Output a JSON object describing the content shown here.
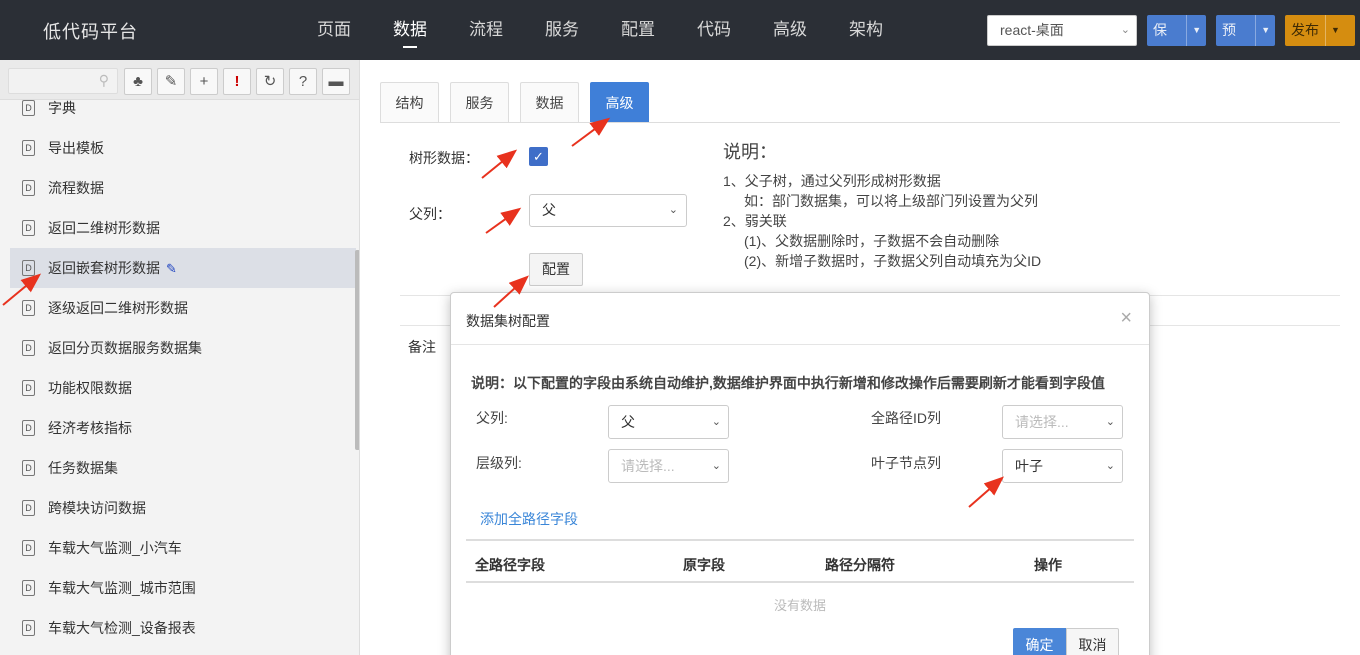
{
  "app": {
    "title": "低代码平台"
  },
  "topnav": {
    "items": [
      {
        "label": "页面",
        "active": false
      },
      {
        "label": "数据",
        "active": true
      },
      {
        "label": "流程",
        "active": false
      },
      {
        "label": "服务",
        "active": false
      },
      {
        "label": "配置",
        "active": false
      },
      {
        "label": "代码",
        "active": false
      },
      {
        "label": "高级",
        "active": false
      },
      {
        "label": "架构",
        "active": false
      }
    ]
  },
  "header": {
    "env_select": "react-桌面",
    "save_label": "保存",
    "preview_label": "预览",
    "publish_label": "发布"
  },
  "sidebar": {
    "toolbar_icons": [
      "search-icon",
      "tree-icon",
      "tag-icon",
      "plus-icon",
      "exclamation-icon",
      "refresh-icon",
      "help-icon",
      "comment-icon"
    ],
    "items": [
      {
        "label": "字典",
        "selected": false
      },
      {
        "label": "导出模板",
        "selected": false
      },
      {
        "label": "流程数据",
        "selected": false
      },
      {
        "label": "返回二维树形数据",
        "selected": false
      },
      {
        "label": "返回嵌套树形数据",
        "selected": true
      },
      {
        "label": "逐级返回二维树形数据",
        "selected": false
      },
      {
        "label": "返回分页数据服务数据集",
        "selected": false
      },
      {
        "label": "功能权限数据",
        "selected": false
      },
      {
        "label": "经济考核指标",
        "selected": false
      },
      {
        "label": "任务数据集",
        "selected": false
      },
      {
        "label": "跨模块访问数据",
        "selected": false
      },
      {
        "label": "车载大气监测_小汽车",
        "selected": false
      },
      {
        "label": "车载大气监测_城市范围",
        "selected": false
      },
      {
        "label": "车载大气检测_设备报表",
        "selected": false
      }
    ]
  },
  "main": {
    "tabs": [
      {
        "label": "结构",
        "active": false
      },
      {
        "label": "服务",
        "active": false
      },
      {
        "label": "数据",
        "active": false
      },
      {
        "label": "高级",
        "active": true
      }
    ],
    "tree_data_label": "树形数据：",
    "tree_data_checked": true,
    "parent_col_label": "父列：",
    "parent_col_value": "父",
    "config_button": "配置",
    "remark_label": "备注",
    "description": {
      "title": "说明：",
      "lines": [
        "1、父子树，通过父列形成树形数据",
        "如：部门数据集，可以将上级部门列设置为父列",
        "2、弱关联",
        "(1)、父数据删除时，子数据不会自动删除",
        "(2)、新增子数据时，子数据父列自动填充为父ID"
      ]
    }
  },
  "modal": {
    "title": "数据集树配置",
    "note": "说明：以下配置的字段由系统自动维护,数据维护界面中执行新增和修改操作后需要刷新才能看到字段值",
    "parent_col_label": "父列:",
    "parent_col_value": "父",
    "full_path_id_label": "全路径ID列",
    "full_path_id_placeholder": "请选择...",
    "level_col_label": "层级列:",
    "level_col_placeholder": "请选择...",
    "leaf_col_label": "叶子节点列",
    "leaf_col_value": "叶子",
    "add_link": "添加全路径字段",
    "table_headers": [
      "全路径字段",
      "原字段",
      "路径分隔符",
      "操作"
    ],
    "empty_text": "没有数据",
    "ok_label": "确定",
    "cancel_label": "取消"
  },
  "colors": {
    "topbar": "#2b2f36",
    "primary": "#4a7ccf",
    "publish": "#d58d10",
    "annotation_arrow": "#e8321e"
  }
}
